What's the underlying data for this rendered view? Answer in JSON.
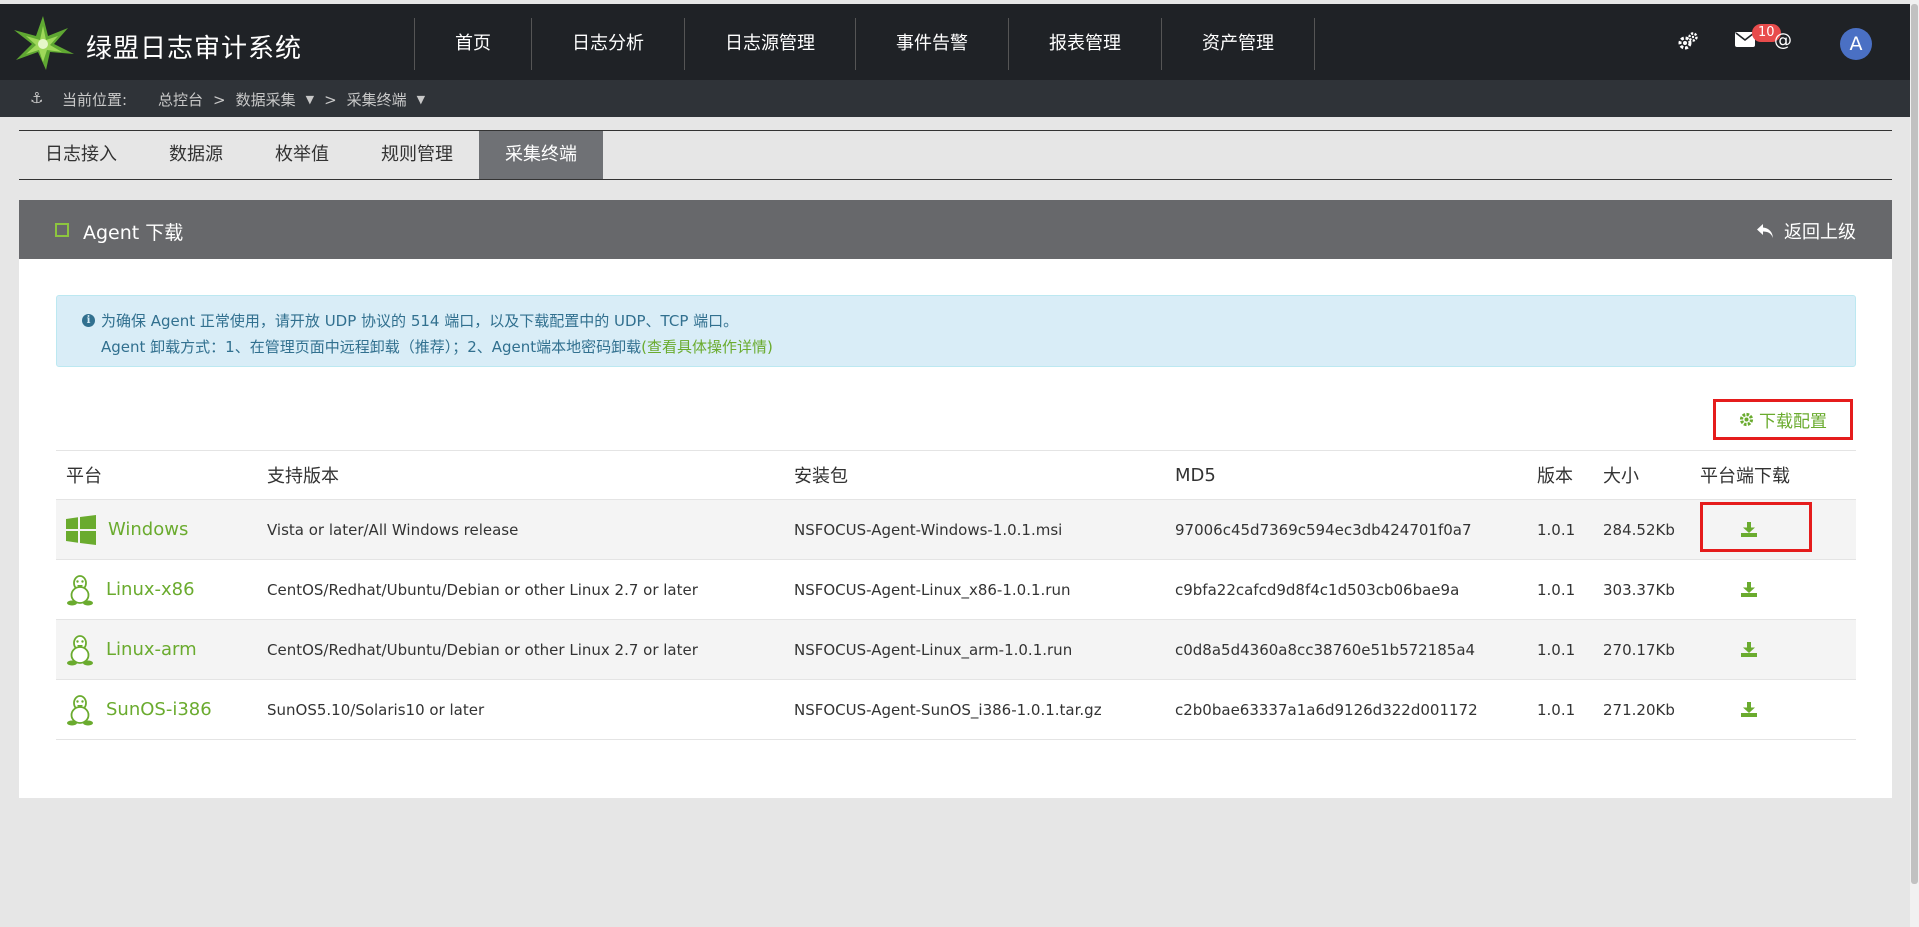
{
  "app": {
    "title": "绿盟日志审计系统"
  },
  "nav": [
    "首页",
    "日志分析",
    "日志源管理",
    "事件告警",
    "报表管理",
    "资产管理"
  ],
  "header": {
    "mail_count": "10",
    "at_symbol": "@",
    "avatar_letter": "A"
  },
  "breadcrumb": {
    "label": "当前位置:",
    "items": [
      "总控台",
      "数据采集",
      "采集终端"
    ],
    "separator": ">"
  },
  "tabs": [
    {
      "label": "日志接入",
      "active": false
    },
    {
      "label": "数据源",
      "active": false
    },
    {
      "label": "枚举值",
      "active": false
    },
    {
      "label": "规则管理",
      "active": false
    },
    {
      "label": "采集终端",
      "active": true
    }
  ],
  "panel": {
    "title": "Agent 下载",
    "back_label": "返回上级"
  },
  "notice": {
    "line1": "为确保 Agent 正常使用，请开放 UDP 协议的 514 端口，以及下载配置中的 UDP、TCP 端口。",
    "line2": "Agent 卸载方式：1、在管理页面中远程卸载（推荐）；2、Agent端本地密码卸载",
    "link": "(查看具体操作详情)"
  },
  "download_config_label": "下载配置",
  "table": {
    "headers": [
      "平台",
      "支持版本",
      "安装包",
      "MD5",
      "版本",
      "大小",
      "平台端下载"
    ],
    "rows": [
      {
        "platform": "Windows",
        "icon": "windows-icon",
        "support": "Vista or later/All Windows release",
        "package": "NSFOCUS-Agent-Windows-1.0.1.msi",
        "md5": "97006c45d7369c594ec3db424701f0a7",
        "version": "1.0.1",
        "size": "284.52Kb"
      },
      {
        "platform": "Linux-x86",
        "icon": "linux-icon",
        "support": "CentOS/Redhat/Ubuntu/Debian or other Linux 2.7 or later",
        "package": "NSFOCUS-Agent-Linux_x86-1.0.1.run",
        "md5": "c9bfa22cafcd9d8f4c1d503cb06bae9a",
        "version": "1.0.1",
        "size": "303.37Kb"
      },
      {
        "platform": "Linux-arm",
        "icon": "linux-icon",
        "support": "CentOS/Redhat/Ubuntu/Debian or other Linux 2.7 or later",
        "package": "NSFOCUS-Agent-Linux_arm-1.0.1.run",
        "md5": "c0d8a5d4360a8cc38760e51b572185a4",
        "version": "1.0.1",
        "size": "270.17Kb"
      },
      {
        "platform": "SunOS-i386",
        "icon": "linux-icon",
        "support": "SunOS5.10/Solaris10 or later",
        "package": "NSFOCUS-Agent-SunOS_i386-1.0.1.tar.gz",
        "md5": "c2b0bae63337a1a6d9126d322d001172",
        "version": "1.0.1",
        "size": "271.20Kb"
      }
    ]
  },
  "colors": {
    "accent_green": "#6aab2e",
    "highlight_red": "#e51c1c",
    "topbar": "#1f2226",
    "panel_head": "#67686b"
  }
}
